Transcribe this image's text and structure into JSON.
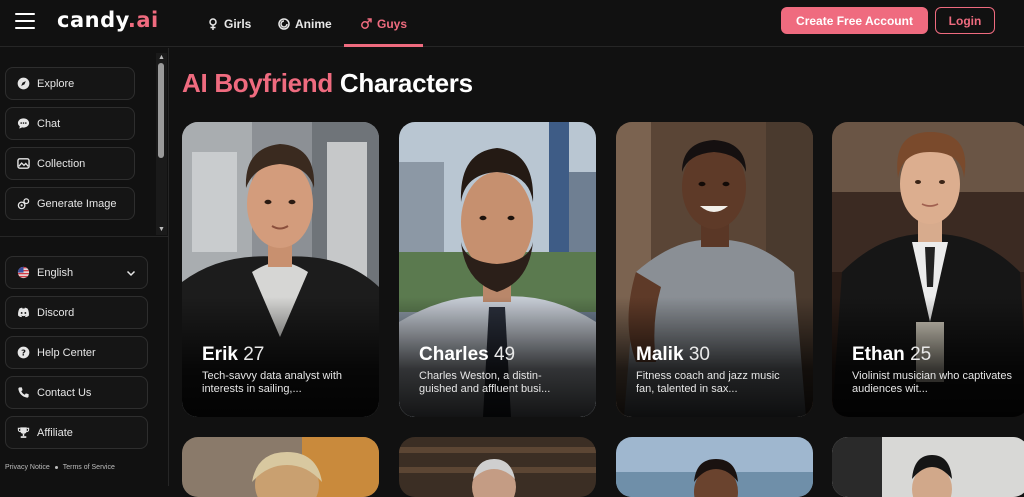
{
  "header": {
    "logo_text": "candy",
    "logo_accent": ".ai",
    "tabs": [
      {
        "label": "Girls",
        "icon": "female-icon"
      },
      {
        "label": "Anime",
        "icon": "anime-icon"
      },
      {
        "label": "Guys",
        "icon": "male-icon",
        "active": true
      }
    ],
    "create_account_label": "Create Free Account",
    "login_label": "Login"
  },
  "sidebar": {
    "items": [
      {
        "label": "Explore",
        "icon": "compass-icon"
      },
      {
        "label": "Chat",
        "icon": "chat-icon"
      },
      {
        "label": "Collection",
        "icon": "collection-icon"
      },
      {
        "label": "Generate Image",
        "icon": "generate-icon"
      }
    ],
    "lower_items": [
      {
        "label": "English",
        "icon": "us-flag-icon",
        "dropdown": true
      },
      {
        "label": "Discord",
        "icon": "discord-icon"
      },
      {
        "label": "Help Center",
        "icon": "help-icon"
      },
      {
        "label": "Contact Us",
        "icon": "contact-icon"
      },
      {
        "label": "Affiliate",
        "icon": "trophy-icon"
      }
    ],
    "footer": {
      "privacy": "Privacy Notice",
      "terms": "Terms of Service"
    }
  },
  "main": {
    "title_accent": "AI Boyfriend",
    "title_rest": " Characters",
    "cards": [
      {
        "name": "Erik",
        "age": "27",
        "description": "Tech-savvy data analyst with interests in sailing,..."
      },
      {
        "name": "Charles",
        "age": "49",
        "description": "Charles Weston, a distin-guished and affluent busi..."
      },
      {
        "name": "Malik",
        "age": "30",
        "description": "Fitness coach and jazz music fan, talented in sax..."
      },
      {
        "name": "Ethan",
        "age": "25",
        "description": "Violinist musician who captivates audiences wit..."
      }
    ]
  },
  "colors": {
    "accent": "#ef6b7f",
    "background": "#111111"
  }
}
